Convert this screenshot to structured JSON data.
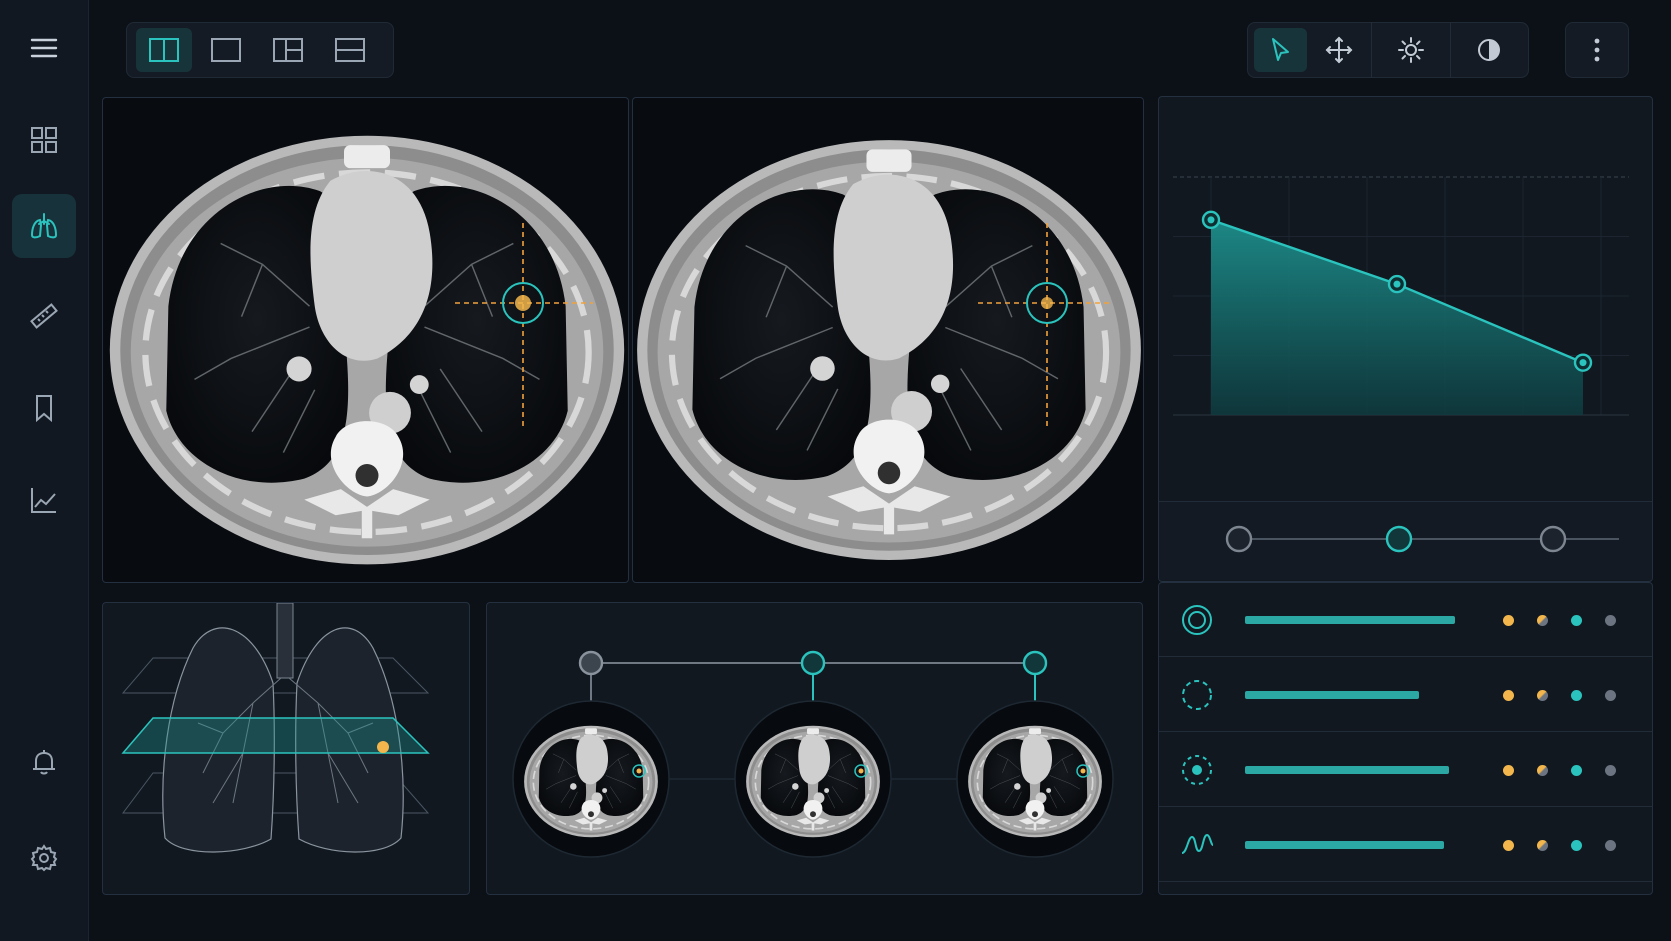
{
  "sidebar": {
    "items": [
      {
        "icon": "menu-icon"
      },
      {
        "icon": "grid-icon"
      },
      {
        "icon": "lungs-icon",
        "active": true
      },
      {
        "icon": "ruler-icon"
      },
      {
        "icon": "bookmark-icon"
      },
      {
        "icon": "trend-chart-icon"
      },
      {
        "icon": "bell-icon"
      },
      {
        "icon": "gear-icon"
      }
    ]
  },
  "layout_toolbar": {
    "buttons": [
      {
        "icon": "split-view-icon",
        "active": true
      },
      {
        "icon": "single-view-icon"
      },
      {
        "icon": "three-pane-view-icon"
      },
      {
        "icon": "stacked-view-icon"
      }
    ]
  },
  "tools_toolbar": {
    "buttons": [
      {
        "icon": "pointer-icon",
        "active": true
      },
      {
        "icon": "pan-icon"
      },
      {
        "icon": "brightness-icon"
      },
      {
        "icon": "contrast-icon"
      }
    ],
    "more": {
      "icon": "more-vertical-icon"
    }
  },
  "colors": {
    "accent": "#2bc3bd",
    "accent_dark": "#1e8b88",
    "marker": "#f2b64c",
    "background": "#0c1117",
    "panel": "#111820"
  },
  "chart_data": {
    "type": "area",
    "x": [
      1,
      2,
      3
    ],
    "values": [
      0.82,
      0.55,
      0.22
    ],
    "grid": true,
    "markers": true
  },
  "timeline": {
    "slider_stops": 3,
    "active_stop": 1,
    "timepoints": [
      {
        "state": "inactive"
      },
      {
        "state": "active"
      },
      {
        "state": "active"
      }
    ]
  },
  "findings": [
    {
      "icon": "ring-target-icon",
      "level": 0.75,
      "dots": [
        "#f2b64c",
        "mixed",
        "#2bc3bd",
        "#6b7480"
      ]
    },
    {
      "icon": "dashed-circle-icon",
      "level": 0.62,
      "dots": [
        "#f2b64c",
        "mixed",
        "#2bc3bd",
        "#6b7480"
      ]
    },
    {
      "icon": "dotted-target-icon",
      "level": 0.73,
      "dots": [
        "#f2b64c",
        "mixed",
        "#2bc3bd",
        "#6b7480"
      ]
    },
    {
      "icon": "waveform-icon",
      "level": 0.71,
      "dots": [
        "#f2b64c",
        "mixed",
        "#2bc3bd",
        "#6b7480"
      ]
    }
  ]
}
